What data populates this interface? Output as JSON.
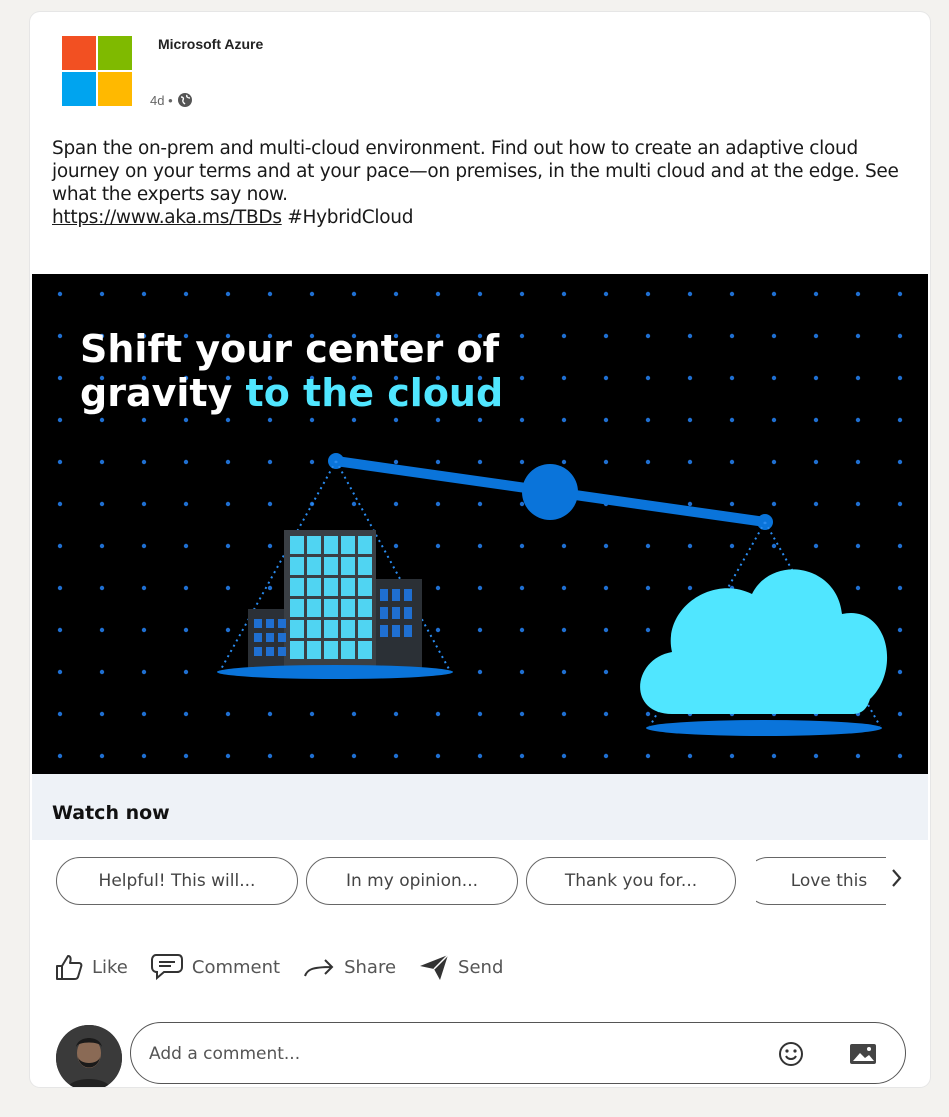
{
  "post": {
    "author": "Microsoft Azure",
    "age": "4d •",
    "text_main": "Span the on-prem and multi-cloud environment. Find out how to create an adaptive cloud journey on your terms and at your pace—on premises, in the multi cloud and at the edge. See what the experts say now.",
    "link": "https://www.aka.ms/TBDs",
    "hashtag": "#HybridCloud"
  },
  "hero": {
    "title_line1": "Shift your center of",
    "title_line2_a": "gravity ",
    "title_line2_b": "to the cloud",
    "accent": "#50e6ff"
  },
  "cta": {
    "label": "Watch now"
  },
  "suggestions": [
    "Helpful! This will...",
    "In my opinion...",
    "Thank you for...",
    "Love this"
  ],
  "actions": {
    "like": "Like",
    "comment": "Comment",
    "share": "Share",
    "send": "Send"
  },
  "comment": {
    "placeholder": "Add a comment..."
  },
  "icons": {
    "globe": "globe-icon",
    "like": "thumbs-up-icon",
    "comment": "speech-bubble-icon",
    "share": "arrow-right-icon",
    "send": "paper-plane-icon",
    "emoji": "smiley-icon",
    "image": "image-icon",
    "next": "chevron-right-icon"
  }
}
